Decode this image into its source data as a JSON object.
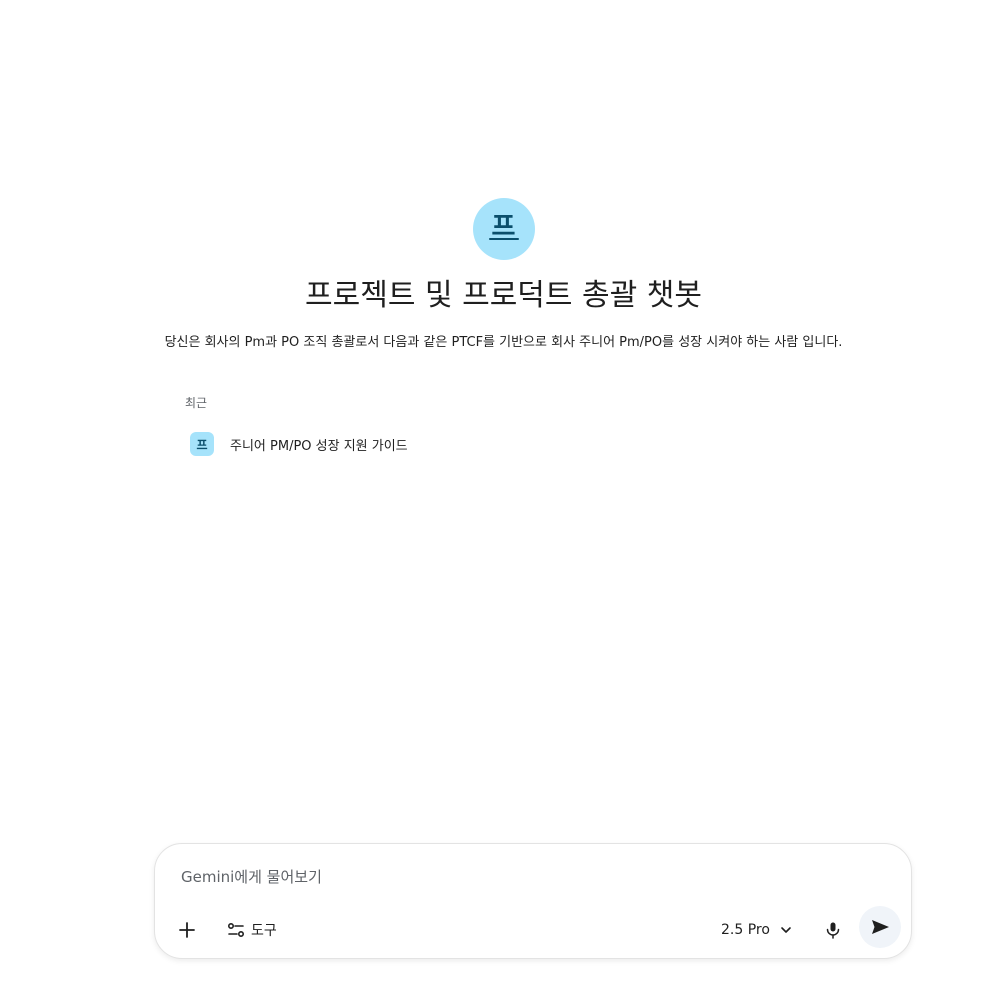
{
  "gem": {
    "avatar_letter": "프",
    "title": "프로젝트 및 프로덕트 총괄 챗봇",
    "description": "당신은 회사의 Pm과 PO 조직 총괄로서 다음과 같은 PTCF를 기반으로 회사 주니어 Pm/PO를 성장 시켜야 하는 사람 입니다."
  },
  "recent": {
    "label": "최근",
    "items": [
      {
        "avatar_letter": "프",
        "title": "주니어 PM/PO 성장 지원 가이드"
      }
    ]
  },
  "composer": {
    "placeholder": "Gemini에게 물어보기",
    "tools_label": "도구",
    "model_label": "2.5 Pro",
    "icons": {
      "add": "plus-icon",
      "tools": "tune-icon",
      "model": "chevron-down-icon",
      "mic": "mic-icon",
      "send": "send-icon"
    }
  },
  "colors": {
    "avatar_bg": "#a6e3fb",
    "avatar_fg": "#0b4f6c",
    "send_bg": "#f0f4f9",
    "text": "#1f1f1f",
    "muted": "#5f6368"
  }
}
